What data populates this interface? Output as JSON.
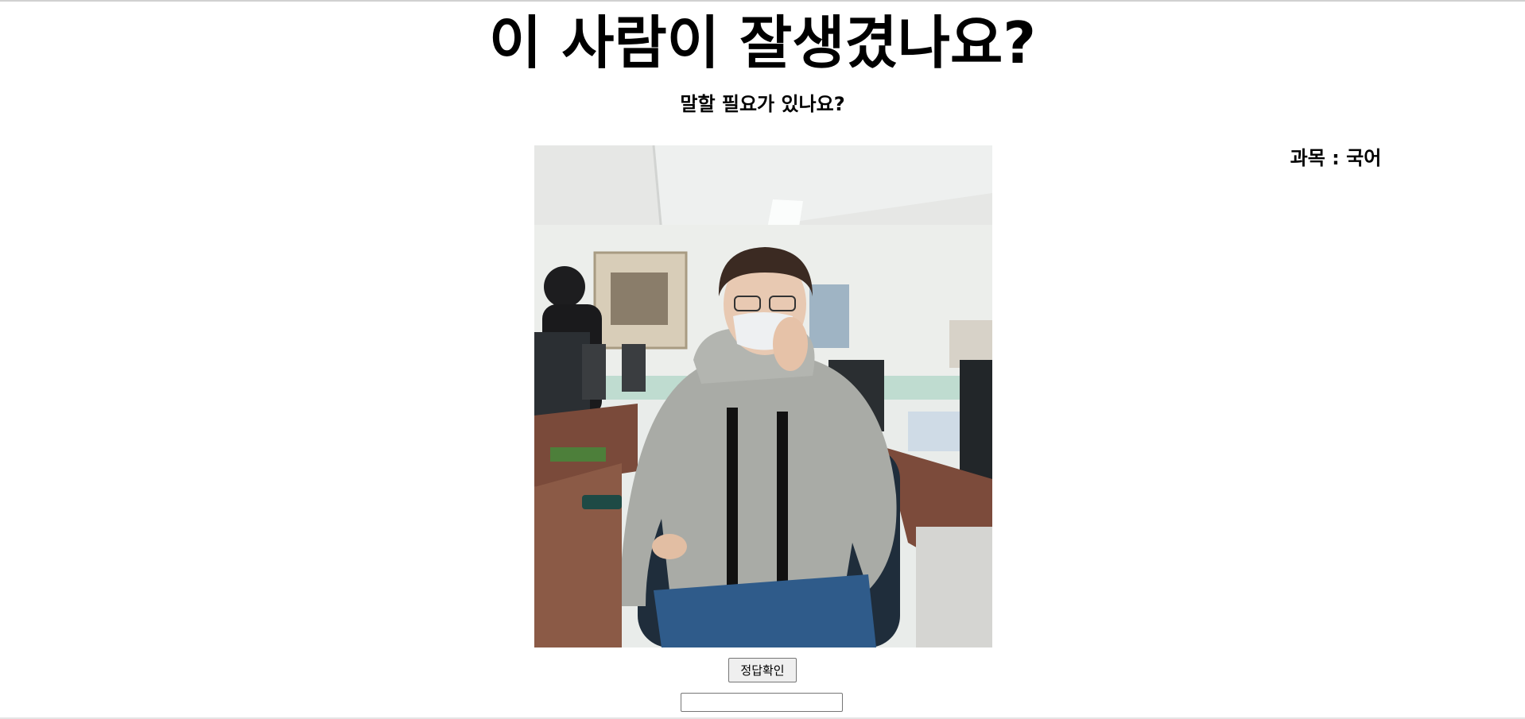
{
  "page": {
    "title": "이 사람이 잘생겼나요?",
    "subtitle": "말할 필요가 있나요?",
    "subject": "과목 : 국어"
  },
  "photo": {
    "icon": "photo-of-person-in-classroom"
  },
  "quiz": {
    "check_answer_label": "정답확인",
    "answer_value": "",
    "answer_placeholder": ""
  },
  "colors": {
    "background": "#ffffff",
    "text": "#000000",
    "button_bg": "#efefef",
    "button_border": "#767676"
  }
}
